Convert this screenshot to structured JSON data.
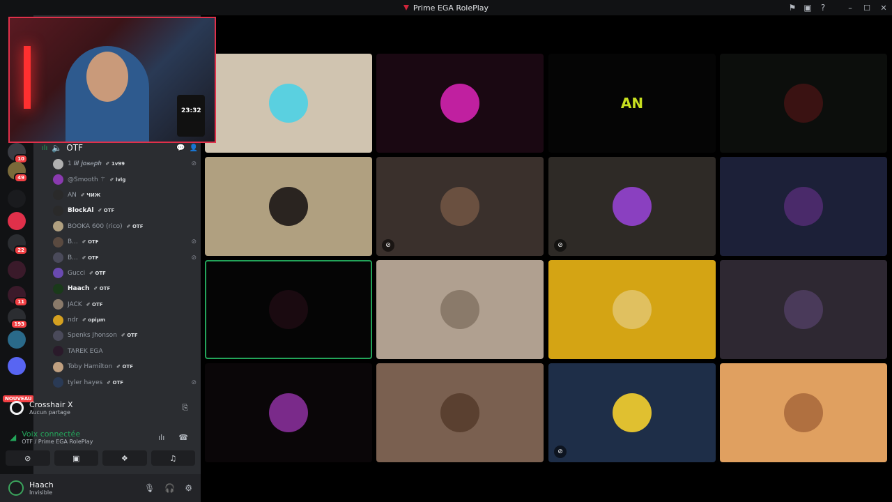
{
  "window": {
    "title": "Prime EGA RolePlay",
    "controls": {
      "minimize": "–",
      "maximize": "☐",
      "close": "✕"
    },
    "icons": [
      "inbox-flag-icon",
      "screen-icon",
      "help-icon"
    ]
  },
  "servers": [
    {
      "name": "server-1",
      "color": "#3a3c43",
      "badge": "10"
    },
    {
      "name": "server-2",
      "color": "#7a6a3a",
      "badge": "49"
    },
    {
      "name": "server-3",
      "color": "#1a1b1e",
      "badge": ""
    },
    {
      "name": "server-prime-ega",
      "color": "#e0304a",
      "badge": ""
    },
    {
      "name": "server-5",
      "color": "#2b2d31",
      "badge": "22"
    },
    {
      "name": "server-6",
      "color": "#3a1a2a",
      "badge": ""
    },
    {
      "name": "server-7",
      "color": "#3a1a2a",
      "badge": "11"
    },
    {
      "name": "server-8",
      "color": "#2b2d31",
      "badge": "193"
    },
    {
      "name": "server-9",
      "color": "#2a6a8a",
      "badge": ""
    },
    {
      "name": "server-folder",
      "color": "#5865f2",
      "badge": ""
    }
  ],
  "new_label": "NOUVEAU",
  "voice_channel": {
    "name": "OTF"
  },
  "members": [
    {
      "name": "1 𝒍𝒊𝒍 𝒋𝒐𝒔𝒆𝒑𝒉",
      "tag": "1v99",
      "color": "#b0b0b0",
      "muted": true,
      "bright": false
    },
    {
      "name": "@Smooth ⚚",
      "tag": "lvlg",
      "color": "#8a3ab0",
      "muted": false,
      "bright": false
    },
    {
      "name": "AN",
      "tag": "ЧИЖ",
      "color": "#2a2a2a",
      "muted": false,
      "bright": false
    },
    {
      "name": "BlockAl",
      "tag": "OTF",
      "color": "#2a2a2a",
      "muted": false,
      "bright": true
    },
    {
      "name": "BOOKA 600 (rico)",
      "tag": "OTF",
      "color": "#b0a080",
      "muted": false,
      "bright": false
    },
    {
      "name": "B...",
      "tag": "OTF",
      "color": "#5a4a40",
      "muted": true,
      "bright": false
    },
    {
      "name": "B...",
      "tag": "OTF",
      "color": "#4a4a5a",
      "muted": true,
      "bright": false
    },
    {
      "name": "Gucci",
      "tag": "OTF",
      "color": "#6a4ab0",
      "muted": false,
      "bright": false
    },
    {
      "name": "Haach",
      "tag": "OTF",
      "color": "#1a3a1a",
      "muted": false,
      "bright": true
    },
    {
      "name": "JACK",
      "tag": "OTF",
      "color": "#8a7a6a",
      "muted": false,
      "bright": false
    },
    {
      "name": "ndr",
      "tag": "opiµm",
      "color": "#d4a020",
      "muted": false,
      "bright": false
    },
    {
      "name": "Spenks Jhonson",
      "tag": "OTF",
      "color": "#4a4a5a",
      "muted": false,
      "bright": false
    },
    {
      "name": "TAREK EGA",
      "tag": "",
      "color": "#2a1a2a",
      "muted": false,
      "bright": false
    },
    {
      "name": "Toby Hamilton",
      "tag": "OTF",
      "color": "#c0a080",
      "muted": false,
      "bright": false
    },
    {
      "name": "tyler hayes",
      "tag": "OTF",
      "color": "#2a3a55",
      "muted": true,
      "bright": false
    }
  ],
  "activity": {
    "title": "Crosshair X",
    "subtitle": "Aucun partage"
  },
  "voice": {
    "title": "Voix connectée",
    "subtitle": "OTF / Prime EGA RolePlay"
  },
  "user": {
    "name": "Haach",
    "status": "Invisible"
  },
  "webcam": {
    "clock": "23:32"
  },
  "tiles": [
    {
      "bg": "#d0c4b0",
      "avatar": "#5ad0e0",
      "muted": false,
      "text": "",
      "active": false
    },
    {
      "bg": "#1a0812",
      "avatar": "#c020a0",
      "muted": false,
      "text": "",
      "active": false
    },
    {
      "bg": "#050505",
      "avatar": "",
      "muted": false,
      "text": "AN",
      "active": false
    },
    {
      "bg": "#0c0e0c",
      "avatar": "#3a1212",
      "muted": false,
      "text": "",
      "active": false
    },
    {
      "bg": "#b0a080",
      "avatar": "#2a2420",
      "muted": false,
      "text": "",
      "active": false
    },
    {
      "bg": "#3a302c",
      "avatar": "#6a5040",
      "muted": true,
      "text": "",
      "active": false
    },
    {
      "bg": "#2e2a26",
      "avatar": "#8a40c0",
      "muted": true,
      "text": "",
      "active": false
    },
    {
      "bg": "#1c2038",
      "avatar": "#4a2a6a",
      "muted": false,
      "text": "",
      "active": false
    },
    {
      "bg": "#050505",
      "avatar": "#1a0a10",
      "muted": false,
      "text": "",
      "active": true
    },
    {
      "bg": "#b0a090",
      "avatar": "#8a7a6a",
      "muted": false,
      "text": "",
      "active": false
    },
    {
      "bg": "#d4a414",
      "avatar": "#e0c060",
      "muted": false,
      "text": "",
      "active": false
    },
    {
      "bg": "#2e2832",
      "avatar": "#4a3a5a",
      "muted": false,
      "text": "",
      "active": false
    },
    {
      "bg": "#0a0608",
      "avatar": "#7a2a8a",
      "muted": false,
      "text": "",
      "active": false
    },
    {
      "bg": "#7a6050",
      "avatar": "#5a4030",
      "muted": false,
      "text": "",
      "active": false
    },
    {
      "bg": "#1e2e48",
      "avatar": "#e0c030",
      "muted": true,
      "text": "",
      "active": false
    },
    {
      "bg": "#e0a060",
      "avatar": "#b07040",
      "muted": false,
      "text": "",
      "active": false
    }
  ]
}
